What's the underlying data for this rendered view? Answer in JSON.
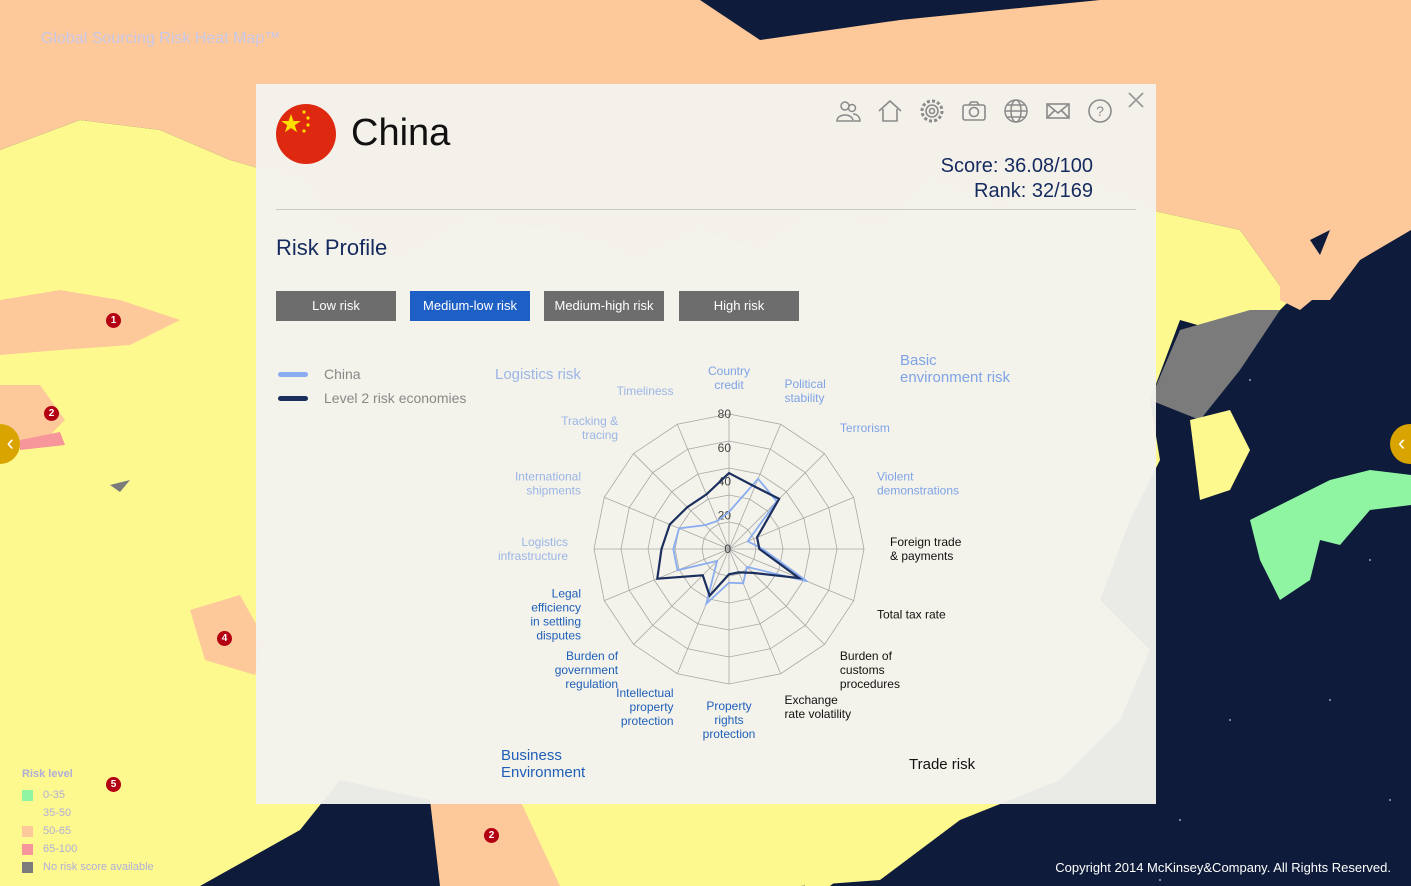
{
  "app": {
    "title": "Global Sourcing Risk Heat Map™",
    "copyright": "Copyright 2014 McKinsey&Company. All Rights Reserved."
  },
  "map_legend": {
    "title": "Risk level",
    "items": [
      {
        "label": "0-35",
        "color": "#8ff5a3"
      },
      {
        "label": "35-50",
        "color": "#fdf98f"
      },
      {
        "label": "50-65",
        "color": "#fdc99a"
      },
      {
        "label": "65-100",
        "color": "#f6969a"
      },
      {
        "label": "No risk score available",
        "color": "#7b7b7b"
      }
    ]
  },
  "map_pins": [
    "1",
    "2",
    "4",
    "5",
    "2",
    "2",
    "2"
  ],
  "panel": {
    "country": "China",
    "score_text": "Score: 36.08/100",
    "rank_text": "Rank: 32/169",
    "section_title": "Risk Profile",
    "buttons": [
      "Low risk",
      "Medium-low risk",
      "Medium-high risk",
      "High risk"
    ],
    "active_button": "Medium-low risk",
    "toolbar_icons": [
      "users-icon",
      "home-icon",
      "gear-icon",
      "camera-icon",
      "globe-icon",
      "mail-icon",
      "help-icon"
    ]
  },
  "colors": {
    "china": "#8aacf0",
    "level2": "#1b2f5e",
    "logistics": "#9bb5e6",
    "basic_env": "#7ea3e6",
    "trade": "#111111",
    "business": "#1f5fb8",
    "active_button": "#1e5fc6"
  },
  "chart_data": {
    "type": "radar",
    "title": "",
    "scale": {
      "min": 0,
      "max": 80,
      "ticks": [
        0,
        20,
        40,
        60,
        80
      ]
    },
    "categories": [
      "Country credit",
      "Political stability",
      "Terrorism",
      "Violent demonstrations",
      "Foreign trade & payments",
      "Total tax rate",
      "Burden of customs procedures",
      "Exchange rate volatility",
      "Property rights protection",
      "Intellectual property protection",
      "Burden of government regulation",
      "Legal efficiency in settling disputes",
      "Logistics infrastructure",
      "International shipments",
      "Tracking & tracing",
      "Timeliness"
    ],
    "groups": [
      {
        "name": "Logistics risk",
        "categories": [
          "Logistics infrastructure",
          "International shipments",
          "Tracking & tracing",
          "Timeliness"
        ]
      },
      {
        "name": "Basic environment risk",
        "categories": [
          "Country credit",
          "Political stability",
          "Terrorism",
          "Violent demonstrations"
        ]
      },
      {
        "name": "Trade risk",
        "categories": [
          "Foreign trade & payments",
          "Total tax rate",
          "Burden of customs procedures",
          "Exchange rate volatility"
        ]
      },
      {
        "name": "Business Environment",
        "categories": [
          "Property rights protection",
          "Intellectual property protection",
          "Burden of government regulation",
          "Legal efficiency in settling disputes"
        ]
      }
    ],
    "series": [
      {
        "name": "China",
        "values": [
          22,
          45,
          40,
          12,
          20,
          50,
          15,
          22,
          20,
          35,
          10,
          33,
          33,
          32,
          20,
          18
        ]
      },
      {
        "name": "Level 2 risk economies",
        "values": [
          45,
          40,
          42,
          18,
          18,
          45,
          20,
          15,
          15,
          30,
          22,
          46,
          40,
          38,
          35,
          35
        ]
      }
    ]
  }
}
